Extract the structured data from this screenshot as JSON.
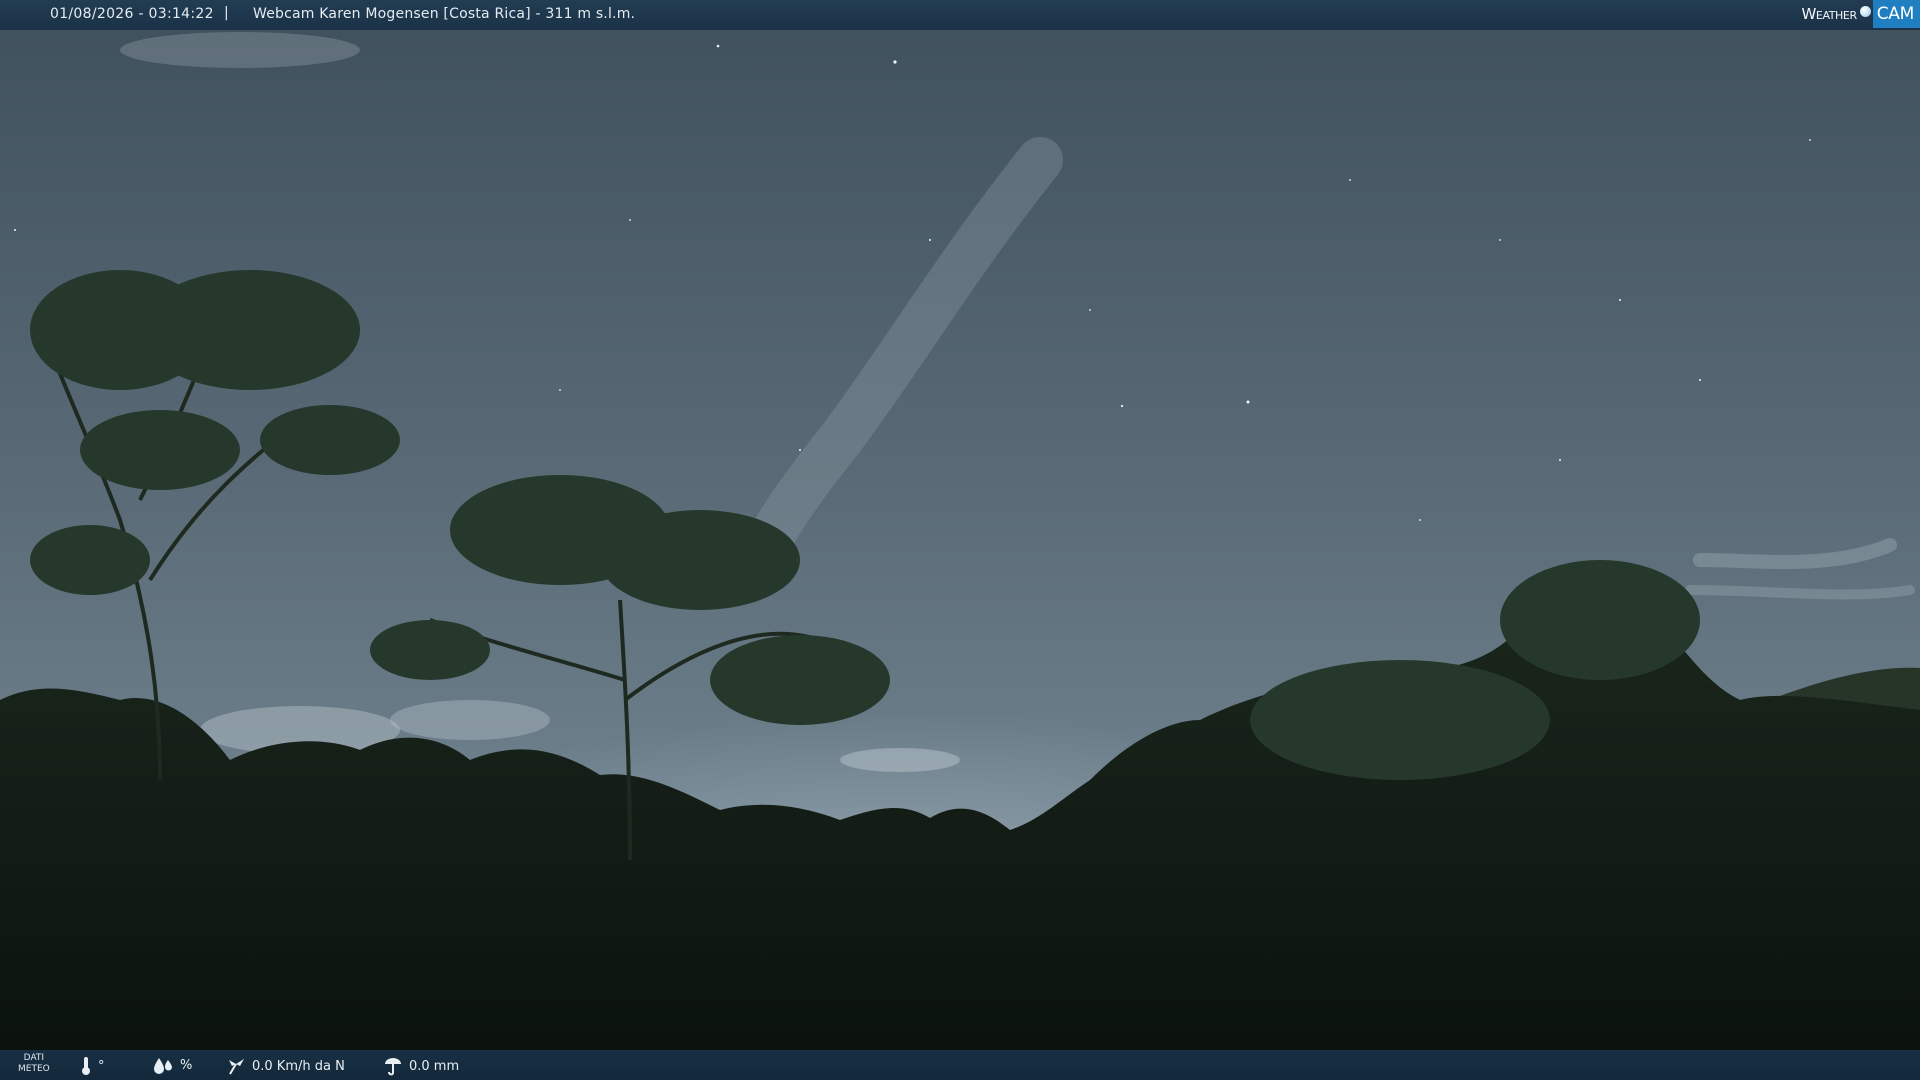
{
  "header": {
    "datetime": "01/08/2026 - 03:14:22",
    "separator": "|",
    "title": "Webcam Karen Mogensen [Costa Rica] - 311 m s.l.m."
  },
  "logo": {
    "weather": "Weather",
    "cam": "CAM"
  },
  "weather_bar": {
    "label_line1": "DATI",
    "label_line2": "METEO",
    "temperature": "°",
    "humidity": "%",
    "wind": "0.0 Km/h da N",
    "rain": "0.0 mm"
  },
  "icons": {
    "temperature": "thermometer-icon",
    "humidity": "humidity-drops-icon",
    "wind": "wind-vane-icon",
    "rain": "rain-gauge-icon"
  },
  "colors": {
    "top_bar": "#1b3247",
    "bottom_bar": "#13283a",
    "logo_accent": "#1f7fc1",
    "sky": "#5c6c78",
    "forest": "#0e1611"
  }
}
